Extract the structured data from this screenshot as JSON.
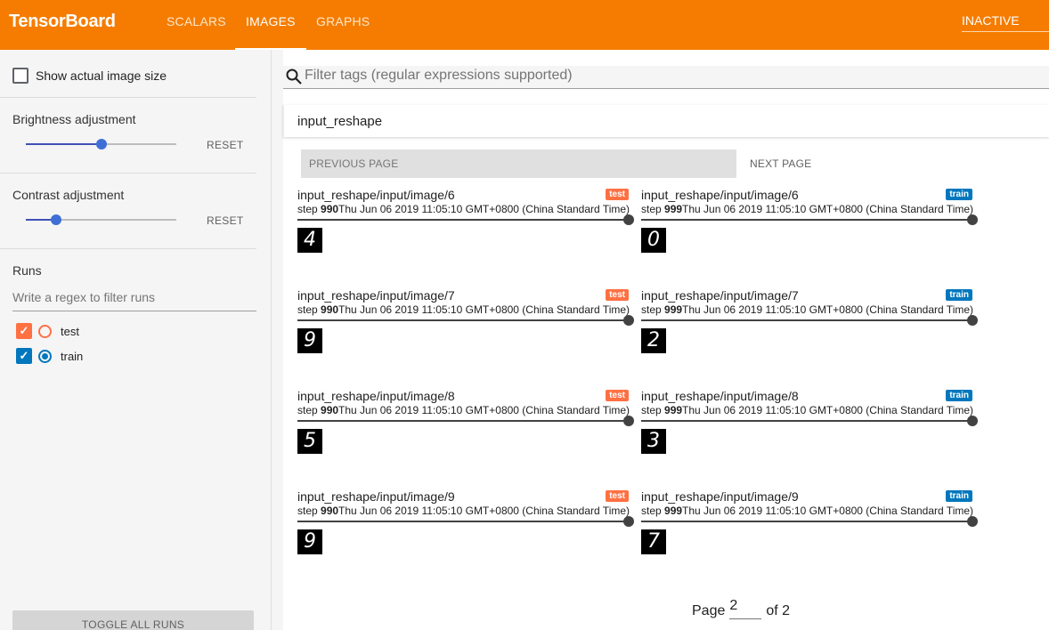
{
  "header": {
    "brand": "TensorBoard",
    "tabs": [
      {
        "label": "SCALARS",
        "active": false
      },
      {
        "label": "IMAGES",
        "active": true
      },
      {
        "label": "GRAPHS",
        "active": false
      }
    ],
    "status": "INACTIVE"
  },
  "sidebar": {
    "show_actual_size": {
      "label": "Show actual image size",
      "checked": false
    },
    "brightness": {
      "label": "Brightness adjustment",
      "reset": "RESET",
      "value": 0.5
    },
    "contrast": {
      "label": "Contrast adjustment",
      "reset": "RESET",
      "value": 0.2
    },
    "runs": {
      "title": "Runs",
      "filter_placeholder": "Write a regex to filter runs",
      "items": [
        {
          "name": "test",
          "color": "#ff7043",
          "checked": true,
          "selected": false
        },
        {
          "name": "train",
          "color": "#0277bd",
          "checked": true,
          "selected": true
        }
      ]
    },
    "toggle_all": "TOGGLE ALL RUNS"
  },
  "main": {
    "filter_placeholder": "Filter tags (regular expressions supported)",
    "tag_group": "input_reshape",
    "prev_page": "PREVIOUS PAGE",
    "next_page": "NEXT PAGE",
    "step_prefix": "step ",
    "cards": [
      {
        "title": "input_reshape/input/image/6",
        "run": "test",
        "step": "990",
        "time": "Thu Jun 06 2019 11:05:10 GMT+0800 (China Standard Time)",
        "digit": "4"
      },
      {
        "title": "input_reshape/input/image/6",
        "run": "train",
        "step": "999",
        "time": "Thu Jun 06 2019 11:05:10 GMT+0800 (China Standard Time)",
        "digit": "0"
      },
      {
        "title": "input_reshape/input/image/7",
        "run": "test",
        "step": "990",
        "time": "Thu Jun 06 2019 11:05:10 GMT+0800 (China Standard Time)",
        "digit": "9"
      },
      {
        "title": "input_reshape/input/image/7",
        "run": "train",
        "step": "999",
        "time": "Thu Jun 06 2019 11:05:10 GMT+0800 (China Standard Time)",
        "digit": "2"
      },
      {
        "title": "input_reshape/input/image/8",
        "run": "test",
        "step": "990",
        "time": "Thu Jun 06 2019 11:05:10 GMT+0800 (China Standard Time)",
        "digit": "5"
      },
      {
        "title": "input_reshape/input/image/8",
        "run": "train",
        "step": "999",
        "time": "Thu Jun 06 2019 11:05:10 GMT+0800 (China Standard Time)",
        "digit": "3"
      },
      {
        "title": "input_reshape/input/image/9",
        "run": "test",
        "step": "990",
        "time": "Thu Jun 06 2019 11:05:10 GMT+0800 (China Standard Time)",
        "digit": "9"
      },
      {
        "title": "input_reshape/input/image/9",
        "run": "train",
        "step": "999",
        "time": "Thu Jun 06 2019 11:05:10 GMT+0800 (China Standard Time)",
        "digit": "7"
      }
    ],
    "pager": {
      "label": "Page",
      "current": "2",
      "of": "of 2"
    }
  },
  "colors": {
    "accent": "#f57c00",
    "test": "#ff7043",
    "train": "#0277bd"
  }
}
